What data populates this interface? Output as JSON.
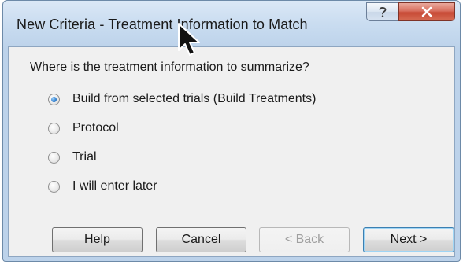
{
  "dialog": {
    "title": "New Criteria - Treatment Information to Match",
    "caption_buttons": {
      "help_icon": "question-mark-icon",
      "close_icon": "close-x-icon"
    },
    "question": "Where is the treatment information to summarize?",
    "options": [
      {
        "label": "Build from selected trials (Build Treatments)",
        "selected": true
      },
      {
        "label": "Protocol",
        "selected": false
      },
      {
        "label": "Trial",
        "selected": false
      },
      {
        "label": "I will enter later",
        "selected": false
      }
    ],
    "buttons": {
      "help": "Help",
      "cancel": "Cancel",
      "back": "< Back",
      "next": "Next >"
    }
  },
  "colors": {
    "title_bar": "#c9dcf0",
    "close_button": "#c74a36",
    "radio_selected": "#2f7fd0",
    "default_button_border": "#3c7fb1"
  }
}
